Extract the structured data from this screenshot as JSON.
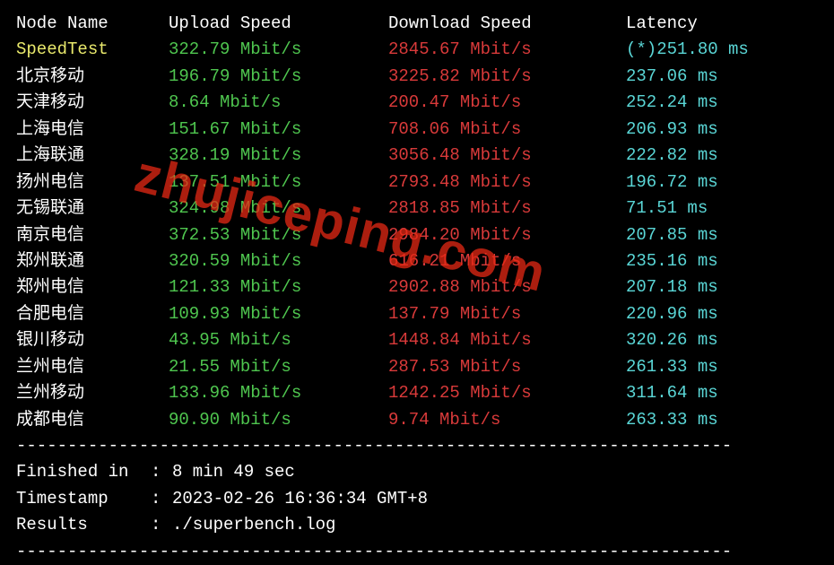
{
  "headers": {
    "node": "Node Name",
    "upload": "Upload Speed",
    "download": "Download Speed",
    "latency": "Latency"
  },
  "speedtest": {
    "name": "SpeedTest",
    "upload": "322.79 Mbit/s",
    "download": "2845.67 Mbit/s",
    "latency": "(*)251.80 ms"
  },
  "rows": [
    {
      "name": "北京移动",
      "upload": "196.79 Mbit/s",
      "download": "3225.82 Mbit/s",
      "latency": "237.06 ms"
    },
    {
      "name": "天津移动",
      "upload": "8.64 Mbit/s",
      "download": "200.47 Mbit/s",
      "latency": "252.24 ms"
    },
    {
      "name": "上海电信",
      "upload": "151.67 Mbit/s",
      "download": "708.06 Mbit/s",
      "latency": "206.93 ms"
    },
    {
      "name": "上海联通",
      "upload": "328.19 Mbit/s",
      "download": "3056.48 Mbit/s",
      "latency": "222.82 ms"
    },
    {
      "name": "扬州电信",
      "upload": "137.51 Mbit/s",
      "download": "2793.48 Mbit/s",
      "latency": "196.72 ms"
    },
    {
      "name": "无锡联通",
      "upload": "324.98 Mbit/s",
      "download": "2818.85 Mbit/s",
      "latency": "71.51 ms"
    },
    {
      "name": "南京电信",
      "upload": "372.53 Mbit/s",
      "download": "2984.20 Mbit/s",
      "latency": "207.85 ms"
    },
    {
      "name": "郑州联通",
      "upload": "320.59 Mbit/s",
      "download": "616.21 Mbit/s",
      "latency": "235.16 ms"
    },
    {
      "name": "郑州电信",
      "upload": "121.33 Mbit/s",
      "download": "2902.88 Mbit/s",
      "latency": "207.18 ms"
    },
    {
      "name": "合肥电信",
      "upload": "109.93 Mbit/s",
      "download": "137.79 Mbit/s",
      "latency": "220.96 ms"
    },
    {
      "name": "银川移动",
      "upload": "43.95 Mbit/s",
      "download": "1448.84 Mbit/s",
      "latency": "320.26 ms"
    },
    {
      "name": "兰州电信",
      "upload": "21.55 Mbit/s",
      "download": "287.53 Mbit/s",
      "latency": "261.33 ms"
    },
    {
      "name": "兰州移动",
      "upload": "133.96 Mbit/s",
      "download": "1242.25 Mbit/s",
      "latency": "311.64 ms"
    },
    {
      "name": "成都电信",
      "upload": "90.90 Mbit/s",
      "download": "9.74 Mbit/s",
      "latency": "263.33 ms"
    }
  ],
  "meta": {
    "finished_label": "Finished in",
    "finished_value": "8 min 49 sec",
    "timestamp_label": "Timestamp",
    "timestamp_value": "2023-02-26 16:36:34 GMT+8",
    "results_label": "Results",
    "results_value": "./superbench.log"
  },
  "divider": "----------------------------------------------------------------------",
  "watermark": "zhujiceping.com"
}
